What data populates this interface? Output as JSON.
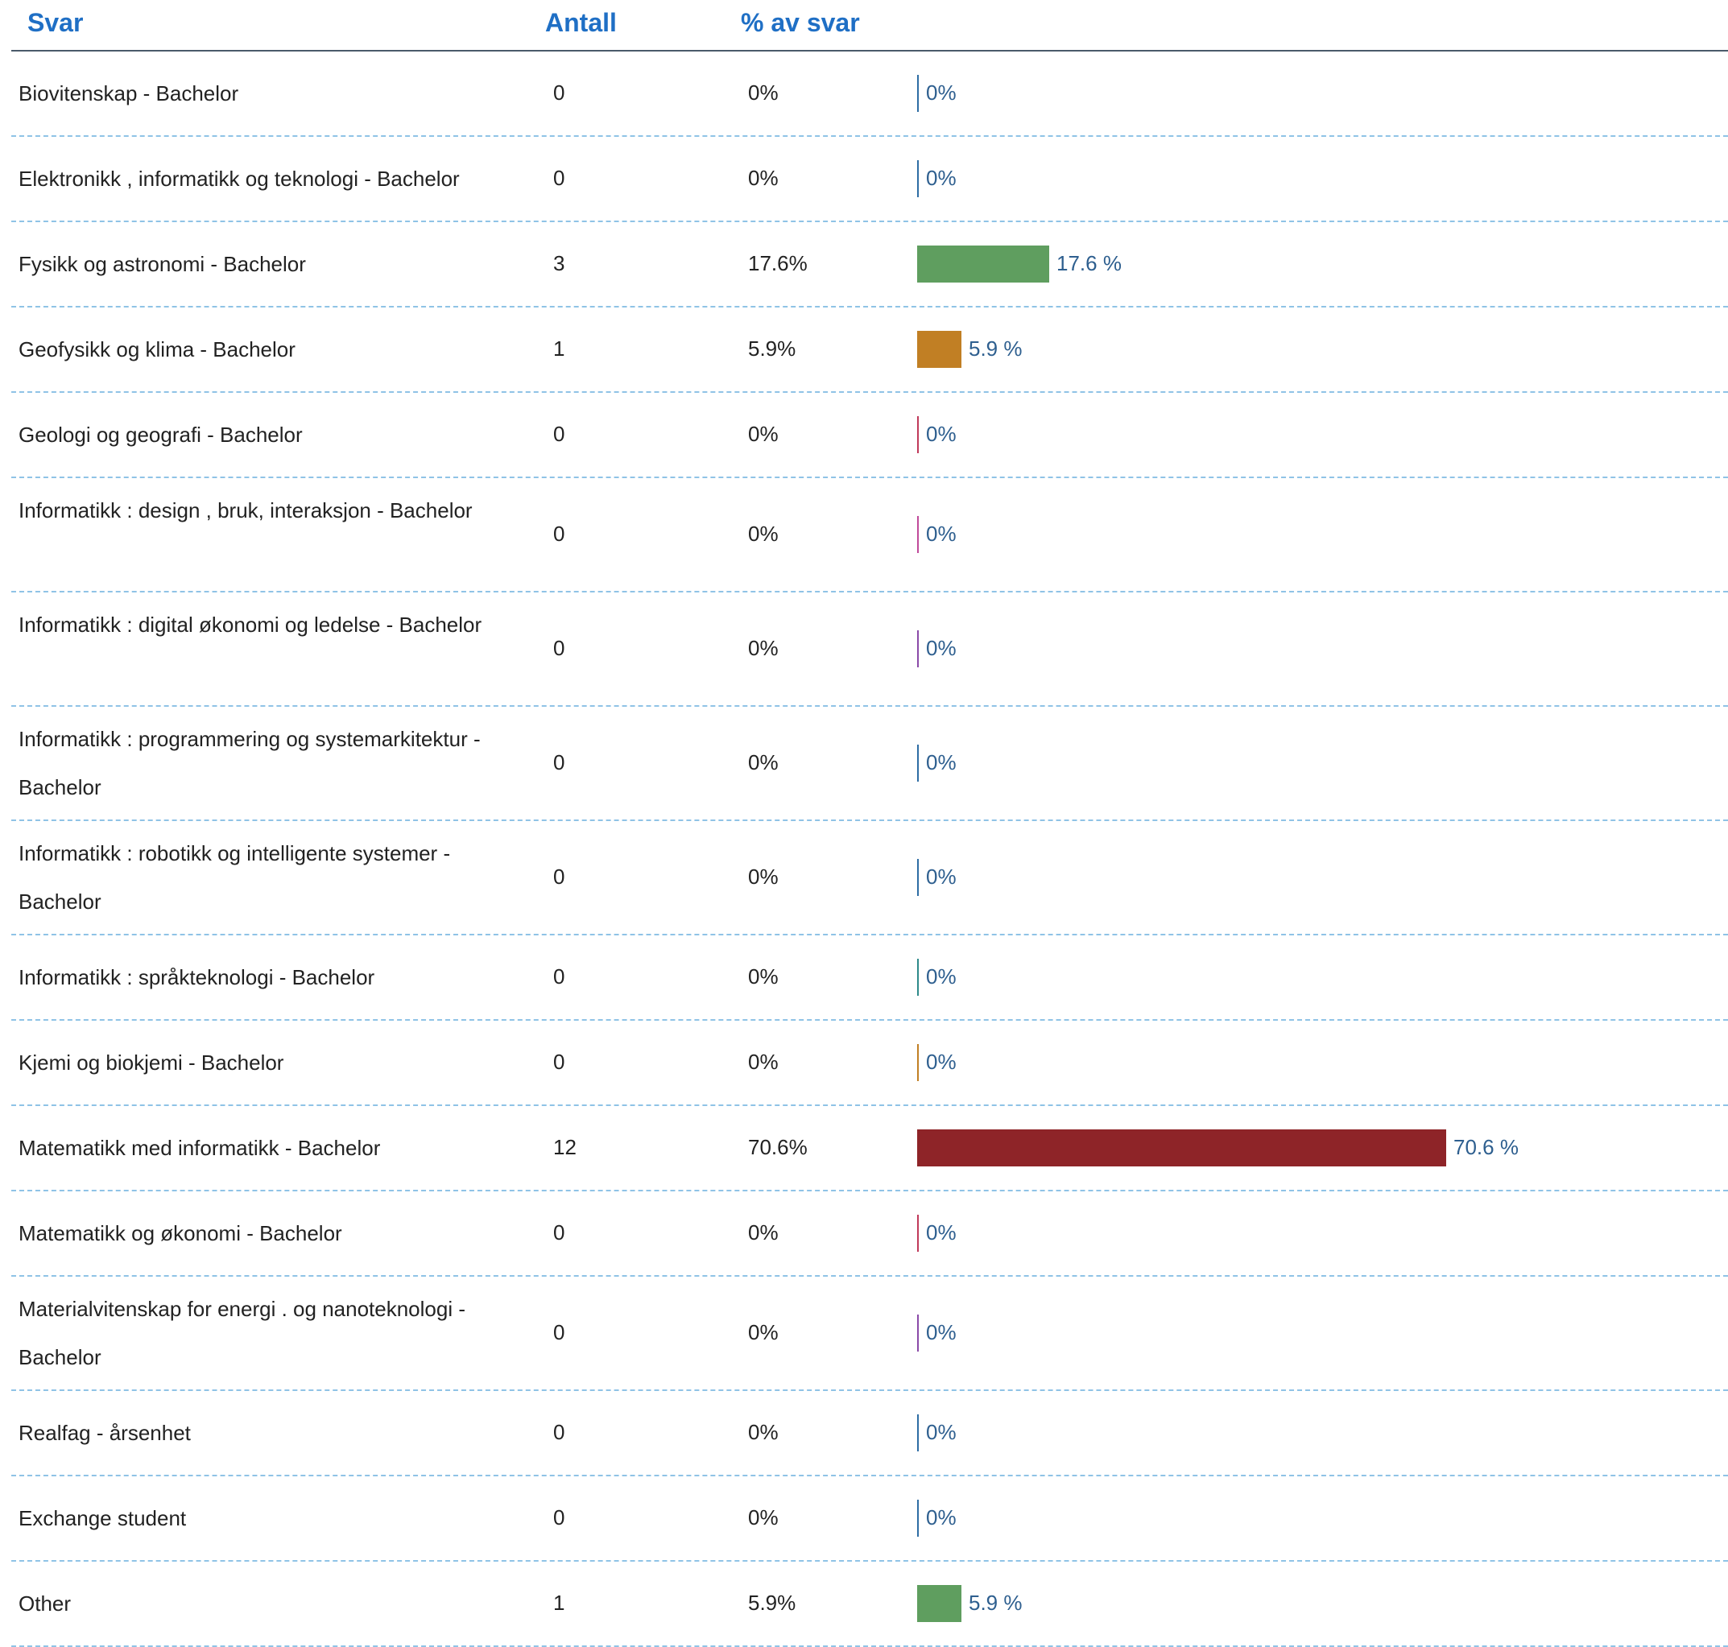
{
  "headers": {
    "svar": "Svar",
    "antall": "Antall",
    "pct": "% av svar"
  },
  "chart_data": {
    "type": "bar",
    "orientation": "horizontal",
    "xlim": [
      0,
      100
    ],
    "categories": [
      "Biovitenskap  - Bachelor",
      "Elektronikk , informatikk  og teknologi  - Bachelor",
      "Fysikk og astronomi  - Bachelor",
      "Geofysikk  og klima - Bachelor",
      "Geologi  og geografi - Bachelor",
      "Informatikk : design , bruk, interaksjon  - Bachelor",
      "Informatikk : digital  økonomi  og ledelse  - Bachelor",
      "Informatikk : programmering  og systemarkitektur  - Bachelor",
      "Informatikk : robotikk  og intelligente  systemer  - Bachelor",
      "Informatikk : språkteknologi  - Bachelor",
      "Kjemi og biokjemi  - Bachelor",
      "Matematikk  med informatikk  - Bachelor",
      "Matematikk  og økonomi  - Bachelor",
      "Materialvitenskap  for energi . og nanoteknologi  - Bachelor",
      "Realfag  - årsenhet",
      "Exchange  student",
      "Other"
    ],
    "counts": [
      "0",
      "0",
      "3",
      "1",
      "0",
      "0",
      "0",
      "0",
      "0",
      "0",
      "0",
      "12",
      "0",
      "0",
      "0",
      "0",
      "1"
    ],
    "values": [
      0,
      0,
      17.6,
      5.9,
      0,
      0,
      0,
      0,
      0,
      0,
      0,
      70.6,
      0,
      0,
      0,
      0,
      5.9
    ],
    "pct_labels": [
      "0%",
      "0%",
      "17.6%",
      "5.9%",
      "0%",
      "0%",
      "0%",
      "0%",
      "0%",
      "0%",
      "0%",
      "70.6%",
      "0%",
      "0%",
      "0%",
      "0%",
      "5.9%"
    ],
    "bar_labels": [
      "0%",
      "0%",
      "17.6 %",
      "5.9 %",
      "0%",
      "0%",
      "0%",
      "0%",
      "0%",
      "0%",
      "0%",
      "70.6 %",
      "0%",
      "0%",
      "0%",
      "0%",
      "5.9 %"
    ],
    "colors": [
      "#2e6da4",
      "#2e6da4",
      "#5f9e5f",
      "#c17f24",
      "#c0395a",
      "#c04a9a",
      "#8a4aa8",
      "#2e6da4",
      "#2e6da4",
      "#2e8a8a",
      "#c17f24",
      "#8e2428",
      "#c0395a",
      "#8a4aa8",
      "#2e6da4",
      "#2e6da4",
      "#5f9e5f"
    ]
  }
}
